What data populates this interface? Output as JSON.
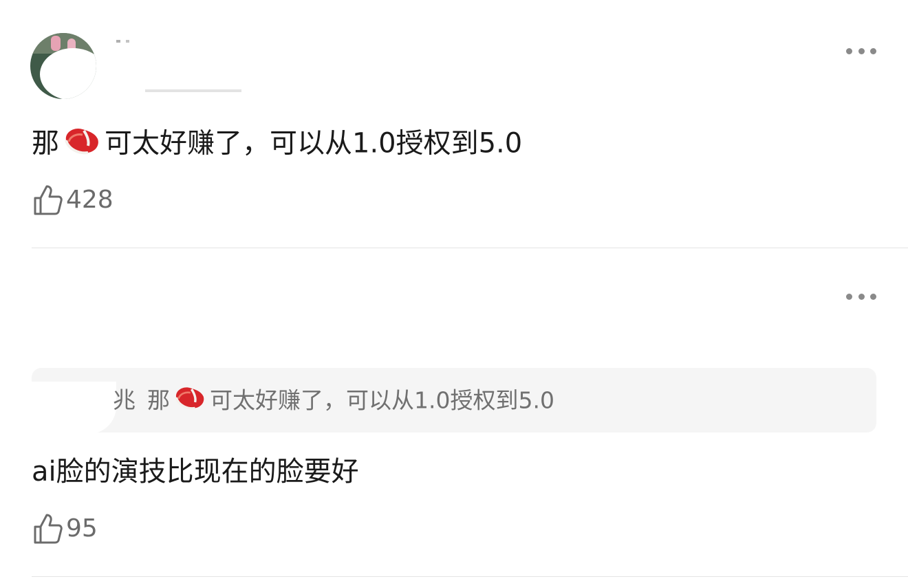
{
  "comments": [
    {
      "text_before": "那",
      "emoji": "steak-emoji",
      "text_after": "可太好赚了，可以从1.0授权到5.0",
      "likes": "428"
    },
    {
      "quote": {
        "author_fragment": "兆",
        "text_before": "那",
        "emoji": "steak-emoji",
        "text_after": "可太好赚了，可以从1.0授权到5.0"
      },
      "text": "ai脸的演技比现在的脸要好",
      "likes": "95"
    }
  ],
  "colors": {
    "text": "#1a1a1a",
    "muted": "#6b6b6b",
    "quote_bg": "#f5f5f5",
    "divider": "#e4e4e4",
    "emoji_red": "#d8262a"
  }
}
